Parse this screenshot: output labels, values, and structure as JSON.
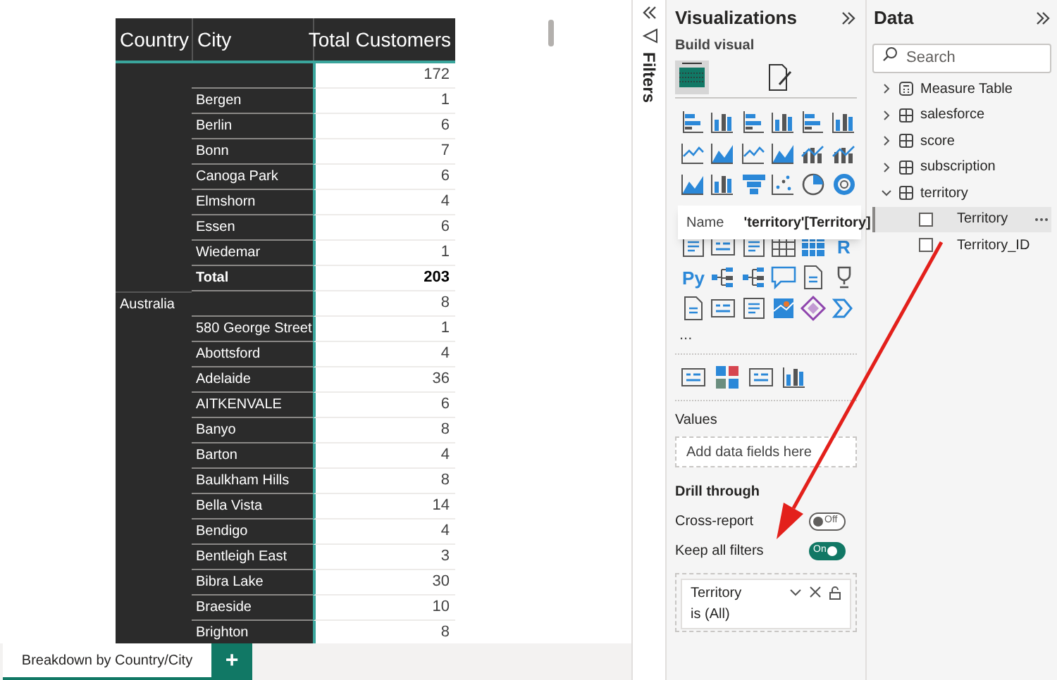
{
  "canvas": {
    "table": {
      "columns": [
        "Country",
        "City",
        "Total Customers"
      ],
      "rows": [
        {
          "kind": "row",
          "country": "",
          "city": "",
          "value": "172"
        },
        {
          "kind": "row",
          "country": "",
          "city": "Bergen",
          "value": "1"
        },
        {
          "kind": "row",
          "country": "",
          "city": "Berlin",
          "value": "6"
        },
        {
          "kind": "row",
          "country": "",
          "city": "Bonn",
          "value": "7"
        },
        {
          "kind": "row",
          "country": "",
          "city": "Canoga Park",
          "value": "6"
        },
        {
          "kind": "row",
          "country": "",
          "city": "Elmshorn",
          "value": "4"
        },
        {
          "kind": "row",
          "country": "",
          "city": "Essen",
          "value": "6"
        },
        {
          "kind": "row",
          "country": "",
          "city": "Wiedemar",
          "value": "1"
        },
        {
          "kind": "total",
          "country": "",
          "city": "Total",
          "value": "203"
        },
        {
          "kind": "row",
          "country": "Australia",
          "city": "",
          "value": "8"
        },
        {
          "kind": "row",
          "country": "",
          "city": "580 George Street",
          "value": "1"
        },
        {
          "kind": "row",
          "country": "",
          "city": "Abottsford",
          "value": "4"
        },
        {
          "kind": "row",
          "country": "",
          "city": "Adelaide",
          "value": "36"
        },
        {
          "kind": "row",
          "country": "",
          "city": "AITKENVALE",
          "value": "6"
        },
        {
          "kind": "row",
          "country": "",
          "city": "Banyo",
          "value": "8"
        },
        {
          "kind": "row",
          "country": "",
          "city": "Barton",
          "value": "4"
        },
        {
          "kind": "row",
          "country": "",
          "city": "Baulkham Hills",
          "value": "8"
        },
        {
          "kind": "row",
          "country": "",
          "city": "Bella Vista",
          "value": "14"
        },
        {
          "kind": "row",
          "country": "",
          "city": "Bendigo",
          "value": "4"
        },
        {
          "kind": "row",
          "country": "",
          "city": "Bentleigh East",
          "value": "3"
        },
        {
          "kind": "row",
          "country": "",
          "city": "Bibra Lake",
          "value": "30"
        },
        {
          "kind": "row",
          "country": "",
          "city": "Braeside",
          "value": "10"
        },
        {
          "kind": "row",
          "country": "",
          "city": "Brighton",
          "value": "8"
        }
      ]
    },
    "page_tabs": [
      {
        "label": "Breakdown by Country/City",
        "selected": true
      }
    ],
    "add_page_button": "+"
  },
  "filters_pane": {
    "title": "Filters"
  },
  "visualizations": {
    "title": "Visualizations",
    "subtitle": "Build visual",
    "modes": [
      {
        "kind": "table",
        "selected": true
      },
      {
        "kind": "format",
        "selected": false
      }
    ],
    "gallery": [
      {
        "kind": "bar_h"
      },
      {
        "kind": "bar_v"
      },
      {
        "kind": "bar_h"
      },
      {
        "kind": "bar_v"
      },
      {
        "kind": "bar_h"
      },
      {
        "kind": "bar_v"
      },
      {
        "kind": "line"
      },
      {
        "kind": "area"
      },
      {
        "kind": "line"
      },
      {
        "kind": "area"
      },
      {
        "kind": "combo"
      },
      {
        "kind": "combo"
      },
      {
        "kind": "area"
      },
      {
        "kind": "bar_v"
      },
      {
        "kind": "funnel"
      },
      {
        "kind": "scatter"
      },
      {
        "kind": "pie"
      },
      {
        "kind": "donut"
      },
      {
        "kind": "list"
      },
      {
        "kind": "card"
      },
      {
        "kind": "list"
      },
      {
        "kind": "table"
      },
      {
        "kind": "matrix"
      },
      {
        "kind": "text",
        "text": "R"
      },
      {
        "kind": "text",
        "text": "Py"
      },
      {
        "kind": "tree"
      },
      {
        "kind": "tree"
      },
      {
        "kind": "bubble"
      },
      {
        "kind": "document"
      },
      {
        "kind": "trophy"
      },
      {
        "kind": "document"
      },
      {
        "kind": "card"
      },
      {
        "kind": "list"
      },
      {
        "kind": "map"
      },
      {
        "kind": "diamond"
      },
      {
        "kind": "chevron"
      }
    ],
    "more": "...",
    "extra_visuals": [
      {
        "kind": "card"
      },
      {
        "kind": "squares"
      },
      {
        "kind": "card"
      },
      {
        "kind": "bar_v"
      }
    ],
    "tooltip": {
      "label": "Name",
      "value": "'territory'[Territory]"
    },
    "values_label": "Values",
    "values_placeholder": "Add data fields here",
    "drill_through": {
      "title": "Drill through",
      "toggles": [
        {
          "label": "Cross-report",
          "on": false,
          "state_text": "Off"
        },
        {
          "label": "Keep all filters",
          "on": true,
          "state_text": "On"
        }
      ]
    },
    "filter_card": {
      "field": "Territory",
      "condition": "is (All)"
    }
  },
  "data_pane": {
    "title": "Data",
    "search": {
      "placeholder": "Search"
    },
    "tables": [
      {
        "name": "Measure Table",
        "kind": "measure",
        "expanded": false
      },
      {
        "name": "salesforce",
        "kind": "table",
        "expanded": false
      },
      {
        "name": "score",
        "kind": "table",
        "expanded": false
      },
      {
        "name": "subscription",
        "kind": "table",
        "expanded": false
      },
      {
        "name": "territory",
        "kind": "table",
        "expanded": true,
        "children": [
          {
            "name": "Territory",
            "checked": false,
            "selected": true
          },
          {
            "name": "Territory_ID",
            "checked": false,
            "selected": false
          }
        ]
      }
    ]
  },
  "annotation": {
    "kind": "arrow"
  }
}
